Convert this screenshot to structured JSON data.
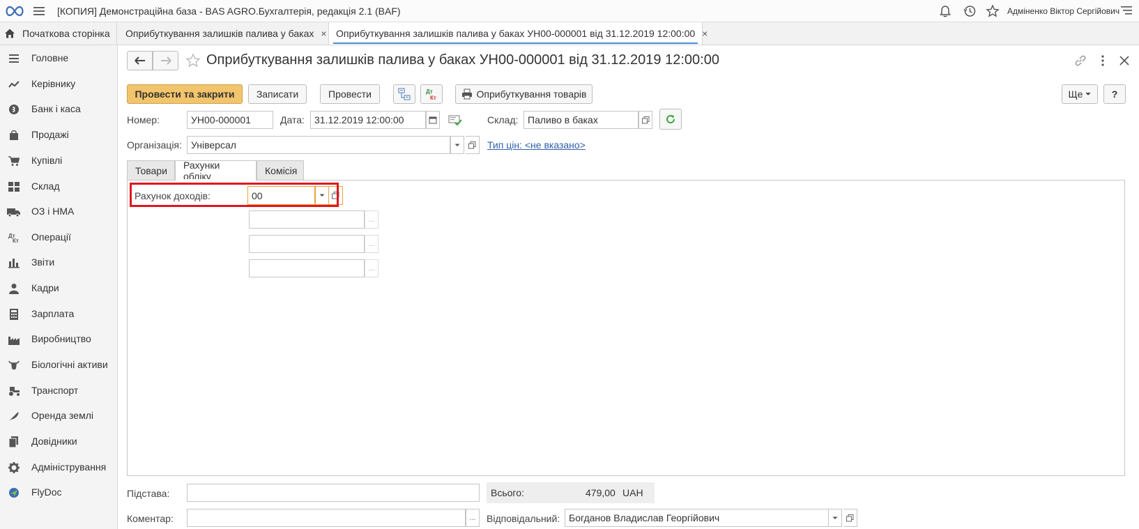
{
  "titlebar": {
    "app_title": "[КОПИЯ] Демонстраційна база - BAS AGRO.Бухгалтерія, редакція 2.1  (BAF)",
    "user_name": "Адміненко Віктор Сергійович"
  },
  "tabs": {
    "home_label": "Початкова сторінка",
    "items": [
      {
        "label": "Оприбуткування залишків палива у баках",
        "close": "×"
      },
      {
        "label": "Оприбуткування залишків палива у баках УН00-000001 від 31.12.2019 12:00:00",
        "close": "×"
      }
    ]
  },
  "sidebar": {
    "items": [
      {
        "label": "Головне",
        "icon": "menu-lines-icon"
      },
      {
        "label": "Керівнику",
        "icon": "trend-chart-icon"
      },
      {
        "label": "Банк і каса",
        "icon": "coin-icon"
      },
      {
        "label": "Продажі",
        "icon": "shopping-bag-icon"
      },
      {
        "label": "Купівлі",
        "icon": "cart-icon"
      },
      {
        "label": "Склад",
        "icon": "warehouse-grid-icon"
      },
      {
        "label": "ОЗ і НМА",
        "icon": "truck-icon"
      },
      {
        "label": "Операції",
        "icon": "debit-credit-icon"
      },
      {
        "label": "Звіти",
        "icon": "bar-chart-icon"
      },
      {
        "label": "Кадри",
        "icon": "person-icon"
      },
      {
        "label": "Зарплата",
        "icon": "calculator-icon"
      },
      {
        "label": "Виробництво",
        "icon": "factory-icon"
      },
      {
        "label": "Біологічні активи",
        "icon": "cow-icon"
      },
      {
        "label": "Транспорт",
        "icon": "tractor-icon"
      },
      {
        "label": "Оренда землі",
        "icon": "feather-icon"
      },
      {
        "label": "Довідники",
        "icon": "books-icon"
      },
      {
        "label": "Адміністрування",
        "icon": "gear-icon"
      },
      {
        "label": "FlyDoc",
        "icon": "flydoc-icon"
      }
    ]
  },
  "form": {
    "title": "Оприбуткування залишків палива у баках УН00-000001 від 31.12.2019 12:00:00",
    "toolbar": {
      "post_close": "Провести та закрити",
      "save": "Записати",
      "post": "Провести",
      "print_goods": "Оприбуткування товарів",
      "more": "Ще",
      "help": "?"
    },
    "number_label": "Номер:",
    "number_value": "УН00-000001",
    "date_label": "Дата:",
    "date_value": "31.12.2019 12:00:00",
    "warehouse_label": "Склад:",
    "warehouse_value": "Паливо в баках",
    "org_label": "Організація:",
    "org_value": "Універсал",
    "price_type_link": "Тип цін: <не вказано>",
    "form_tabs": [
      "Товари",
      "Рахунки обліку",
      "Комісія"
    ],
    "active_tab": "Рахунки обліку",
    "income_account_label": "Рахунок доходів:",
    "income_account_value": "00",
    "subconto_1": "",
    "subconto_2": "",
    "subconto_3": "",
    "ellipsis": "...",
    "basis_label": "Підстава:",
    "basis_value": "",
    "total_label": "Всього:",
    "total_value": "479,00",
    "total_currency": "UAH",
    "comment_label": "Коментар:",
    "comment_value": "",
    "responsible_label": "Відповідальний:",
    "responsible_value": "Богданов Владислав Георгійович"
  },
  "colors": {
    "primary_button": "#f2c46b",
    "highlight_frame": "#e0161d",
    "active_tab_underline": "#4a8ad3",
    "link": "#2f5fa8"
  }
}
